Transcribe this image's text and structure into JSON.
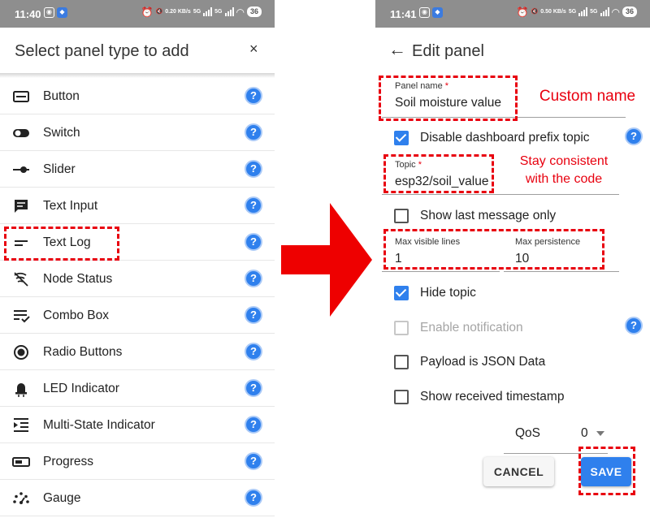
{
  "colors": {
    "accent": "#2f80ed",
    "annotation": "#e8000f",
    "status_bar": "#8e8e8e"
  },
  "left_screen": {
    "status": {
      "time": "11:40",
      "speed": "0.20 KB/s",
      "network": "5G",
      "battery": "36"
    },
    "sheet_title": "Select panel type to add",
    "close_label": "×",
    "panel_types": [
      {
        "label": "Button",
        "icon": "button-icon"
      },
      {
        "label": "Switch",
        "icon": "switch-icon"
      },
      {
        "label": "Slider",
        "icon": "slider-icon"
      },
      {
        "label": "Text Input",
        "icon": "text-input-icon"
      },
      {
        "label": "Text Log",
        "icon": "text-log-icon"
      },
      {
        "label": "Node Status",
        "icon": "node-status-icon"
      },
      {
        "label": "Combo Box",
        "icon": "combo-box-icon"
      },
      {
        "label": "Radio Buttons",
        "icon": "radio-icon"
      },
      {
        "label": "LED Indicator",
        "icon": "led-icon"
      },
      {
        "label": "Multi-State Indicator",
        "icon": "multi-state-icon"
      },
      {
        "label": "Progress",
        "icon": "progress-icon"
      },
      {
        "label": "Gauge",
        "icon": "gauge-icon"
      }
    ],
    "help_glyph": "?"
  },
  "right_screen": {
    "status": {
      "time": "11:41",
      "speed": "0.50 KB/s",
      "network": "5G",
      "battery": "36"
    },
    "title": "Edit panel",
    "back_icon": "arrow-left-icon",
    "panel_name": {
      "label": "Panel name",
      "required": "*",
      "value": "Soil moisture value"
    },
    "disable_prefix": {
      "label": "Disable dashboard prefix topic",
      "checked": true
    },
    "topic": {
      "label": "Topic",
      "required": "*",
      "value": "esp32/soil_value"
    },
    "show_last_message": {
      "label": "Show last message only",
      "checked": false
    },
    "max_visible_lines": {
      "label": "Max visible lines",
      "value": "1"
    },
    "max_persistence": {
      "label": "Max persistence",
      "value": "10"
    },
    "hide_topic": {
      "label": "Hide topic",
      "checked": true
    },
    "enable_notification": {
      "label": "Enable notification",
      "checked": false,
      "disabled": true
    },
    "payload_json": {
      "label": "Payload is JSON Data",
      "checked": false
    },
    "show_timestamp": {
      "label": "Show received timestamp",
      "checked": false
    },
    "qos": {
      "label": "QoS",
      "value": "0"
    },
    "cancel_label": "CANCEL",
    "save_label": "SAVE"
  },
  "annotations": {
    "custom_name": "Custom name",
    "stay_consistent_line1": "Stay consistent",
    "stay_consistent_line2": "with the code"
  }
}
